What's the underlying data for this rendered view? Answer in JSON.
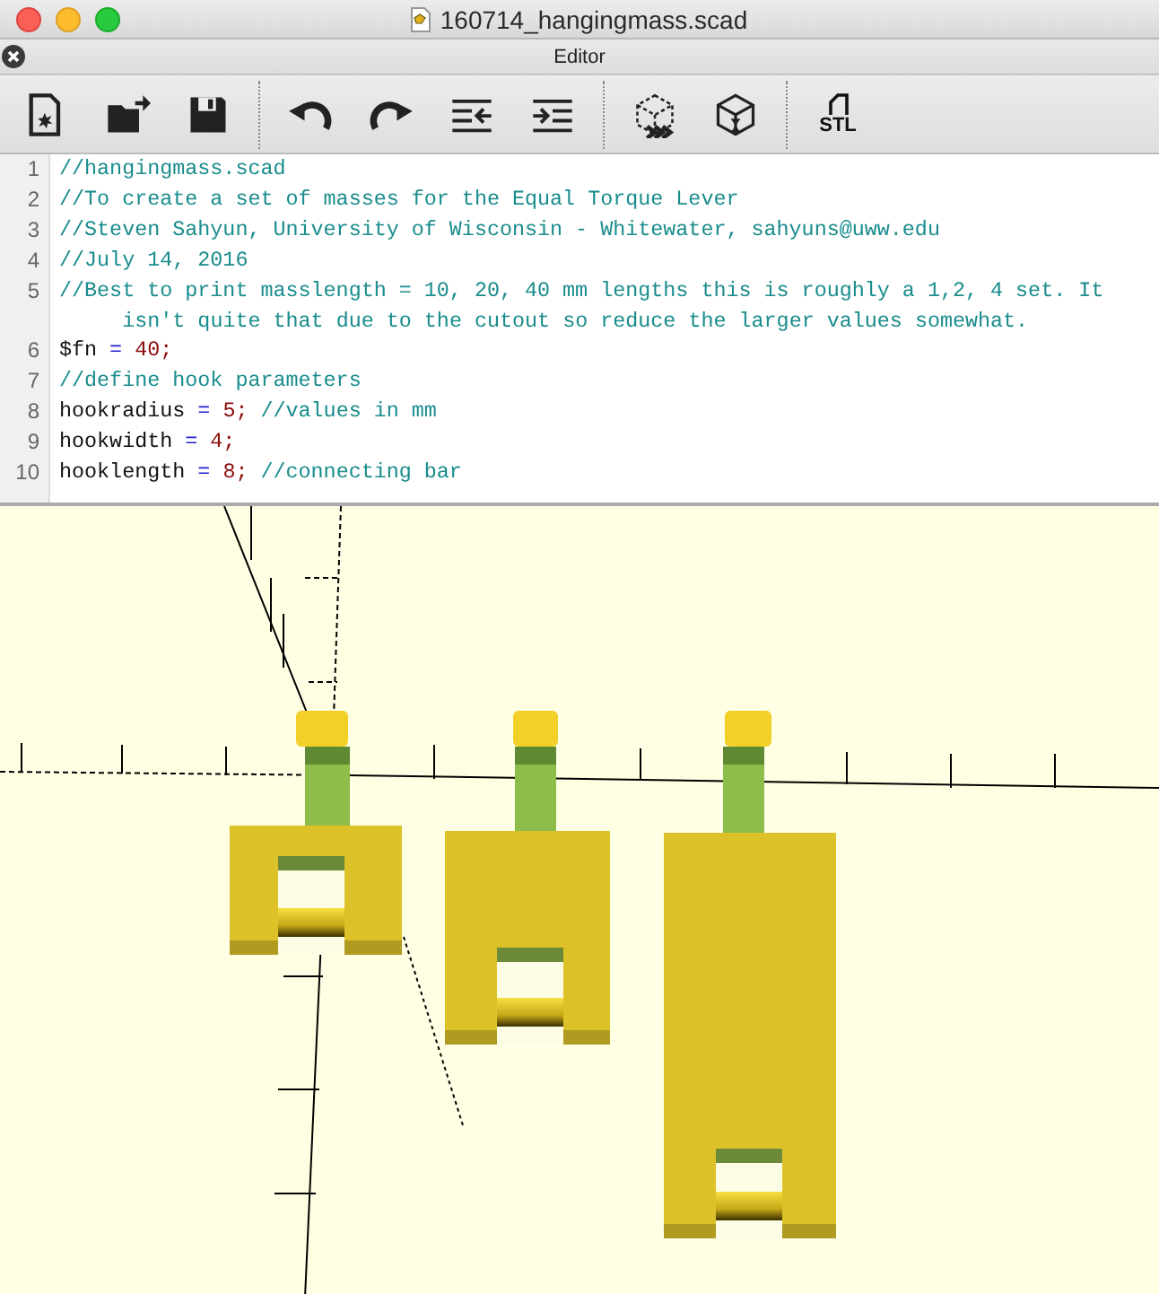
{
  "window": {
    "title": "160714_hangingmass.scad"
  },
  "editor_panel": {
    "title": "Editor"
  },
  "toolbar": [
    {
      "kind": "new"
    },
    {
      "kind": "open"
    },
    {
      "kind": "save",
      "group_end": true
    },
    {
      "kind": "undo"
    },
    {
      "kind": "redo"
    },
    {
      "kind": "unindent"
    },
    {
      "kind": "indent",
      "group_end": true
    },
    {
      "kind": "preview"
    },
    {
      "kind": "render",
      "group_end": true
    },
    {
      "kind": "export",
      "label": "STL"
    }
  ],
  "code_lines": [
    {
      "number": "1",
      "tokens": [
        {
          "kind": "comment",
          "text": "//hangingmass.scad"
        }
      ]
    },
    {
      "number": "2",
      "tokens": [
        {
          "kind": "comment",
          "text": "//To create a set of masses for the Equal Torque Lever"
        }
      ]
    },
    {
      "number": "3",
      "tokens": [
        {
          "kind": "comment",
          "text": "//Steven Sahyun, University of Wisconsin - Whitewater, sahyuns@uww.edu"
        }
      ]
    },
    {
      "number": "4",
      "tokens": [
        {
          "kind": "comment",
          "text": "//July 14, 2016"
        }
      ]
    },
    {
      "number": "5",
      "tokens": [
        {
          "kind": "comment",
          "text": "//Best to print masslength = 10, 20, 40 mm lengths this is roughly a 1,2, 4 set. It isn't quite that due to the cutout so reduce the larger values somewhat."
        }
      ]
    },
    {
      "number": "6",
      "tokens": [
        {
          "kind": "ident",
          "text": "$fn"
        },
        {
          "kind": "op",
          "text": " = "
        },
        {
          "kind": "number",
          "text": "40;"
        }
      ]
    },
    {
      "number": "7",
      "tokens": [
        {
          "kind": "comment",
          "text": "//define hook parameters"
        }
      ]
    },
    {
      "number": "8",
      "tokens": [
        {
          "kind": "ident",
          "text": "hookradius"
        },
        {
          "kind": "op",
          "text": " = "
        },
        {
          "kind": "number",
          "text": "5;"
        },
        {
          "kind": "comment",
          "text": " //values in mm"
        }
      ]
    },
    {
      "number": "9",
      "tokens": [
        {
          "kind": "ident",
          "text": "hookwidth"
        },
        {
          "kind": "op",
          "text": " = "
        },
        {
          "kind": "number",
          "text": "4;"
        }
      ]
    },
    {
      "number": "10",
      "tokens": [
        {
          "kind": "ident",
          "text": "hooklength"
        },
        {
          "kind": "op",
          "text": " = "
        },
        {
          "kind": "number",
          "text": "8;"
        },
        {
          "kind": "comment",
          "text": " //connecting bar"
        }
      ]
    }
  ]
}
